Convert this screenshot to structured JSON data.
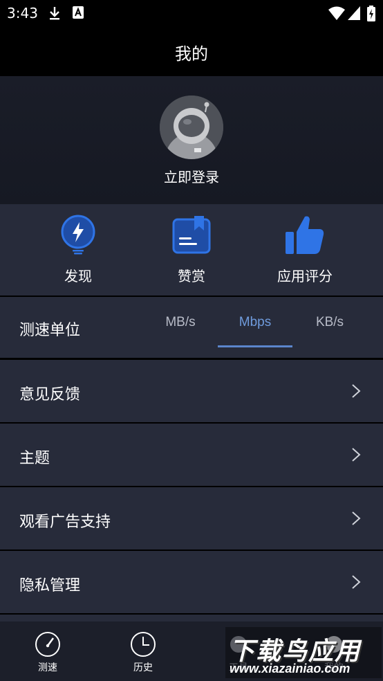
{
  "status_bar": {
    "time": "3:43"
  },
  "header": {
    "title": "我的"
  },
  "profile": {
    "login_label": "立即登录"
  },
  "quick_actions": [
    {
      "label": "发现",
      "icon": "lightning-bulb-icon"
    },
    {
      "label": "赞赏",
      "icon": "bookmark-book-icon"
    },
    {
      "label": "应用评分",
      "icon": "thumbs-up-icon"
    }
  ],
  "speed_unit": {
    "label": "测速单位",
    "options": [
      "MB/s",
      "Mbps",
      "KB/s"
    ],
    "selected": "Mbps"
  },
  "menu": [
    {
      "label": "意见反馈"
    },
    {
      "label": "主题"
    },
    {
      "label": "观看广告支持"
    },
    {
      "label": "隐私管理"
    }
  ],
  "bottom_nav": [
    {
      "label": "测速",
      "icon": "speedometer-icon"
    },
    {
      "label": "历史",
      "icon": "clock-icon"
    },
    {
      "label": "工具",
      "icon": "tools-icon"
    },
    {
      "label": "我的",
      "icon": "profile-icon"
    }
  ],
  "watermark": {
    "title": "下载鸟应用",
    "url": "www.xiazainiao.com"
  },
  "colors": {
    "background": "#000000",
    "panel": "#272b3a",
    "accent": "#5b86cc",
    "icon_blue": "#2f74e6"
  }
}
